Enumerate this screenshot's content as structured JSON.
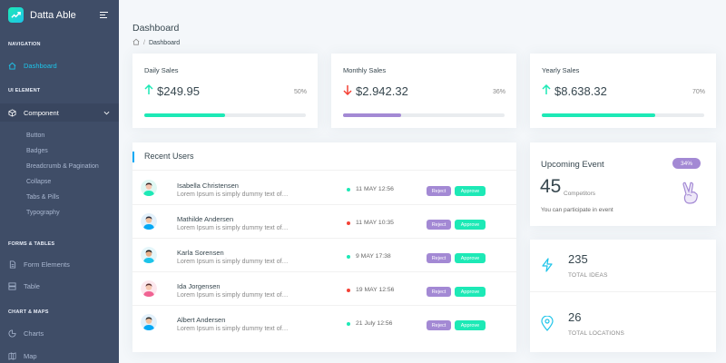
{
  "brand": {
    "name": "Datta Able"
  },
  "sidebar": {
    "captions": {
      "navigation": "NAVIGATION",
      "ui_element": "UI ELEMENT",
      "forms_tables": "FORMS & TABLES",
      "chart_maps": "CHART & MAPS"
    },
    "items": {
      "dashboard": "Dashboard",
      "component": "Component",
      "form_elements": "Form Elements",
      "table": "Table",
      "charts": "Charts",
      "map": "Map"
    },
    "submenu": [
      "Button",
      "Badges",
      "Breadcrumb & Pagination",
      "Collapse",
      "Tabs & Pills",
      "Typography"
    ]
  },
  "header": {
    "title": "Dashboard",
    "breadcrumb_current": "Dashboard"
  },
  "sales": [
    {
      "title": "Daily Sales",
      "value": "$249.95",
      "percent": "50%",
      "progress": 50,
      "trend": "up",
      "color": "#1de9b6"
    },
    {
      "title": "Monthly Sales",
      "value": "$2.942.32",
      "percent": "36%",
      "progress": 36,
      "trend": "down",
      "color": "#a389d4"
    },
    {
      "title": "Yearly Sales",
      "value": "$8.638.32",
      "percent": "70%",
      "progress": 70,
      "trend": "up",
      "color": "#1de9b6"
    }
  ],
  "recent_users": {
    "title": "Recent Users",
    "reject_label": "Reject",
    "approve_label": "Approve",
    "rows": [
      {
        "name": "Isabella Christensen",
        "desc": "Lorem Ipsum is simply dummy text of…",
        "date": "11 MAY 12:56",
        "status": "green"
      },
      {
        "name": "Mathilde Andersen",
        "desc": "Lorem Ipsum is simply dummy text of…",
        "date": "11 MAY 10:35",
        "status": "red"
      },
      {
        "name": "Karla Sorensen",
        "desc": "Lorem Ipsum is simply dummy text of…",
        "date": "9 MAY 17:38",
        "status": "green"
      },
      {
        "name": "Ida Jorgensen",
        "desc": "Lorem Ipsum is simply dummy text of…",
        "date": "19 MAY 12:56",
        "status": "red"
      },
      {
        "name": "Albert Andersen",
        "desc": "Lorem Ipsum is simply dummy text of…",
        "date": "21 July 12:56",
        "status": "green"
      }
    ]
  },
  "event": {
    "title": "Upcoming Event",
    "badge": "34%",
    "count": "45",
    "count_label": "Competitors",
    "desc": "You can participate in event"
  },
  "stats": [
    {
      "icon": "lightning-icon",
      "value": "235",
      "label": "TOTAL IDEAS"
    },
    {
      "icon": "location-pin-icon",
      "value": "26",
      "label": "TOTAL LOCATIONS"
    }
  ],
  "colors": {
    "sidebar": "#3f4d67",
    "accent": "#1dc4e9",
    "green": "#1de9b6",
    "purple": "#a389d4",
    "red": "#f44236"
  }
}
